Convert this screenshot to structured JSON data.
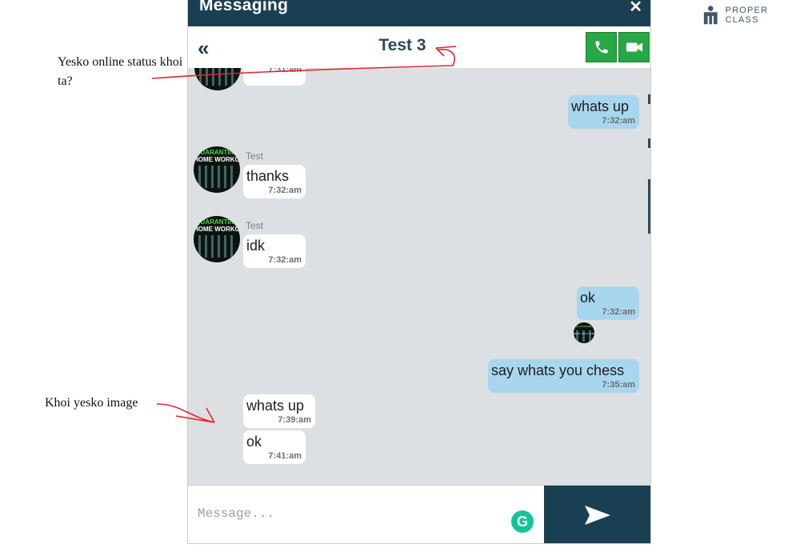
{
  "annotations": {
    "online_status_note": "Yesko online status khoi ta?",
    "image_note": "Khoi yesko image"
  },
  "brand": {
    "text": "PROPER CLASS",
    "icon": "proper-class-logo-icon"
  },
  "window": {
    "title": "Messaging",
    "close_icon": "close-icon"
  },
  "chat_header": {
    "back_icon": "double-chevron-left-icon",
    "name": "Test 3",
    "call_icon": "phone-icon",
    "video_icon": "video-camera-icon"
  },
  "avatar_image": {
    "line1": "QUARANTINE",
    "line2": "HOME WORKOUT"
  },
  "messages": [
    {
      "direction": "in",
      "text": "",
      "time": "7:31:am"
    },
    {
      "direction": "out",
      "text": "whats up",
      "time": "7:32:am"
    },
    {
      "direction": "in",
      "sender": "Test",
      "text": "thanks",
      "time": "7:32:am"
    },
    {
      "direction": "in",
      "sender": "Test",
      "text": "idk",
      "time": "7:32:am"
    },
    {
      "direction": "out",
      "text": "ok",
      "time": "7:32:am"
    },
    {
      "direction": "out",
      "text": "say whats you chess",
      "time": "7:35:am"
    },
    {
      "direction": "in",
      "text": "whats up",
      "time": "7:39:am"
    },
    {
      "direction": "in",
      "text": "ok",
      "time": "7:41:am"
    }
  ],
  "composer": {
    "placeholder": "Message...",
    "grammarly_icon": "grammarly-icon",
    "send_icon": "send-arrow-icon"
  },
  "colors": {
    "header_bg": "#1b3f52",
    "chat_bg": "#dde0e2",
    "outgoing_bubble": "#a8d6ee",
    "incoming_bubble": "#ffffff",
    "call_green": "#28a745",
    "annotation_ink": "#e0262a"
  }
}
